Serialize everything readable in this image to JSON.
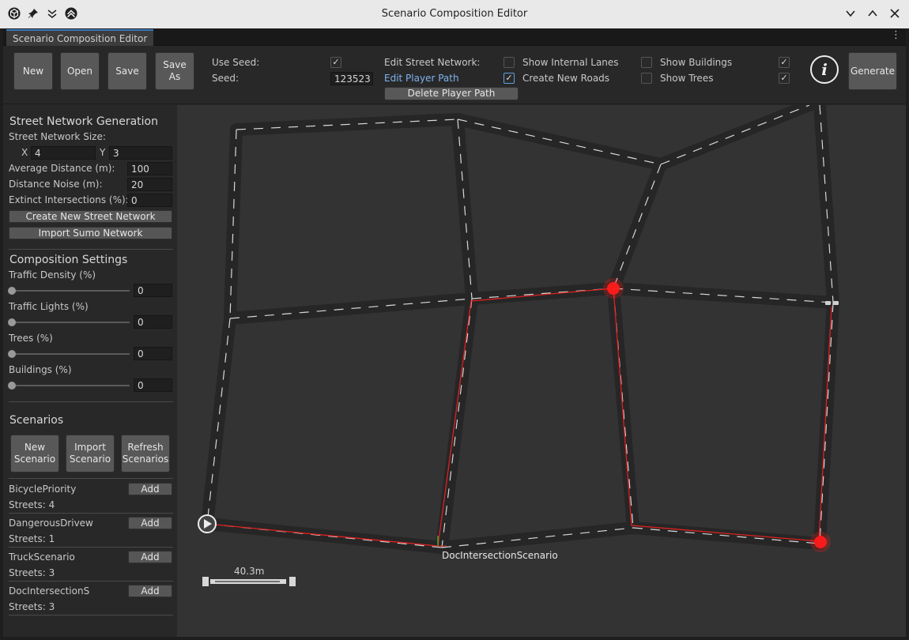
{
  "window": {
    "title": "Scenario Composition Editor"
  },
  "tab": {
    "label": "Scenario Composition Editor"
  },
  "toolbar": {
    "new_label": "New",
    "open_label": "Open",
    "save_label": "Save",
    "save_as_label": "Save\nAs",
    "use_seed_label": "Use Seed:",
    "use_seed_checked": "✓",
    "seed_label": "Seed:",
    "seed_value": "123523",
    "edit_street_network_label": "Edit Street Network:",
    "edit_player_path_label": "Edit Player Path",
    "edit_player_path_checked": "✓",
    "delete_player_path_label": "Delete Player Path",
    "show_internal_lanes_label": "Show Internal Lanes",
    "create_new_roads_label": "Create New Roads",
    "show_buildings_label": "Show Buildings",
    "show_buildings_checked": "✓",
    "show_trees_label": "Show Trees",
    "show_trees_checked": "✓",
    "info_icon": "i",
    "generate_label": "Generate"
  },
  "street_network": {
    "title": "Street Network Generation",
    "size_label": "Street Network Size:",
    "x_label": "X",
    "x_value": "4",
    "y_label": "Y",
    "y_value": "3",
    "avg_distance_label": "Average Distance (m):",
    "avg_distance_value": "100",
    "distance_noise_label": "Distance Noise (m):",
    "distance_noise_value": "20",
    "extinct_label": "Extinct Intersections (%):",
    "extinct_value": "0",
    "create_button": "Create New Street Network",
    "import_button": "Import Sumo Network"
  },
  "composition": {
    "title": "Composition Settings",
    "sliders": [
      {
        "label": "Traffic Density (%)",
        "value": "0"
      },
      {
        "label": "Traffic Lights (%)",
        "value": "0"
      },
      {
        "label": "Trees (%)",
        "value": "0"
      },
      {
        "label": "Buildings (%)",
        "value": "0"
      }
    ]
  },
  "scenarios": {
    "title": "Scenarios",
    "new_button": "New\nScenario",
    "import_button": "Import\nScenario",
    "refresh_button": "Refresh\nScenarios",
    "add_label": "Add",
    "items": [
      {
        "name": "BicyclePriority",
        "streets": "Streets: 4"
      },
      {
        "name": "DangerousDrivew",
        "streets": "Streets: 1"
      },
      {
        "name": "TruckScenario",
        "streets": "Streets: 3"
      },
      {
        "name": "DocIntersectionS",
        "streets": "Streets: 3"
      }
    ]
  },
  "map": {
    "scenario_label": "DocIntersectionScenario",
    "scale_label": "40.3m",
    "road_color": "#262626",
    "path_color": "#e02020",
    "node_color": "#ff1a1a",
    "background": "#333333"
  }
}
